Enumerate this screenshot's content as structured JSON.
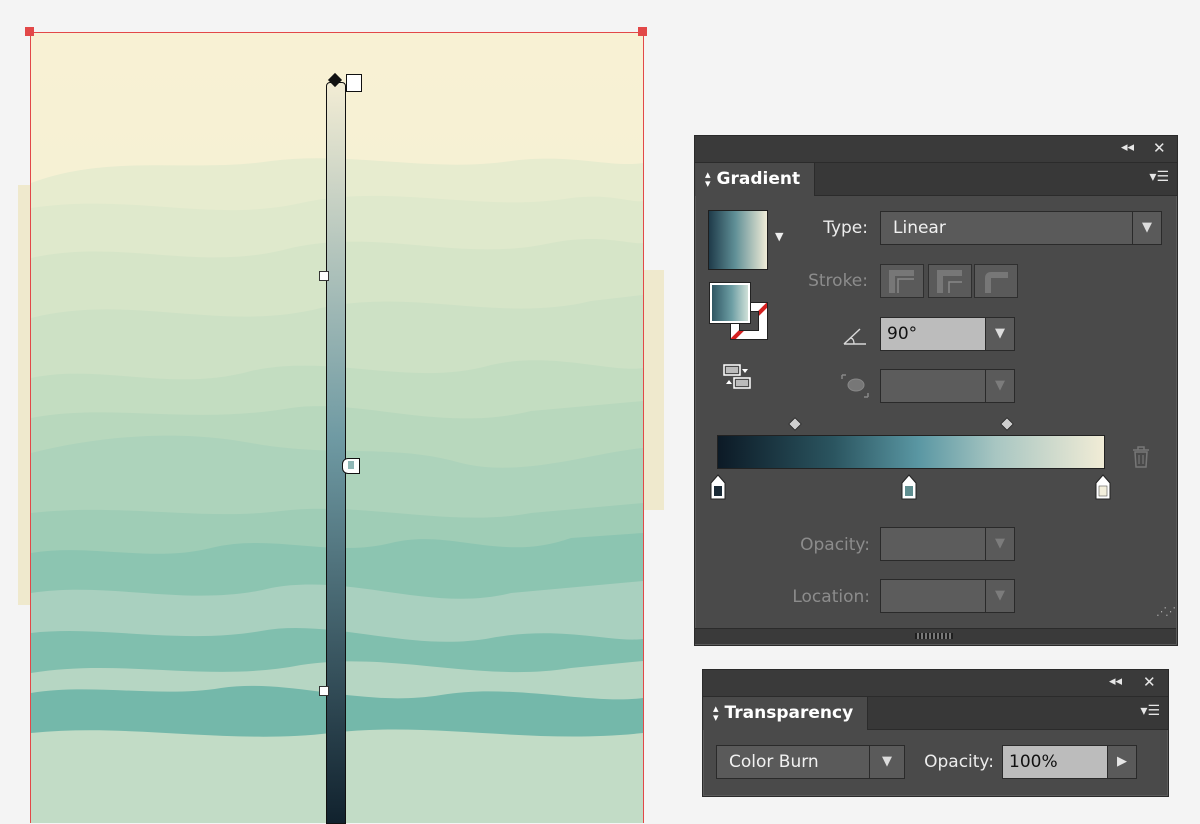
{
  "gradient_panel": {
    "title": "Gradient",
    "type_label": "Type:",
    "type_value": "Linear",
    "stroke_label": "Stroke:",
    "angle_value": "90°",
    "aspect_value": "",
    "opacity_label": "Opacity:",
    "opacity_value": "",
    "location_label": "Location:",
    "location_value": "",
    "gradient_stops": [
      {
        "color": "#1a2a36",
        "location": 0
      },
      {
        "color": "#5f8e90",
        "location": 50
      },
      {
        "color": "#f3efdc",
        "location": 100
      }
    ]
  },
  "transparency_panel": {
    "title": "Transparency",
    "blend_mode": "Color Burn",
    "opacity_label": "Opacity:",
    "opacity_value": "100%"
  },
  "colors": {
    "artboard_background": "#f5efd0",
    "selection_red": "#e24848",
    "panel_bg": "#4a4a4a",
    "panel_dark": "#383838"
  },
  "icons": {
    "collapse": "double-chevron-left-icon",
    "close": "close-icon",
    "menu": "panel-menu-icon",
    "delete": "trash-icon"
  }
}
